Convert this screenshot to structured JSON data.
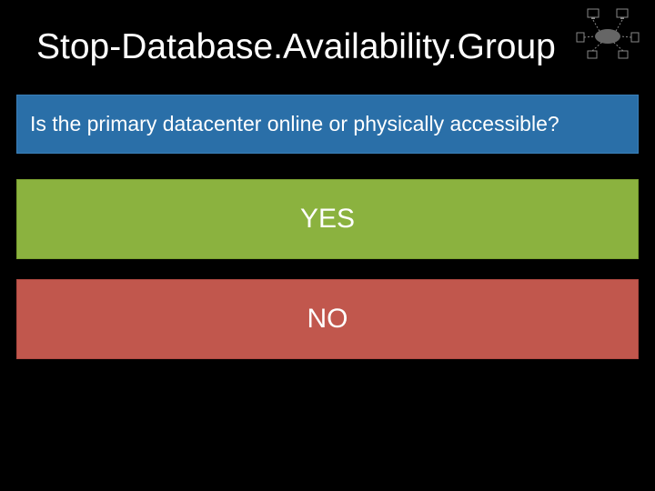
{
  "header": {
    "title": "Stop-Database.Availability.Group"
  },
  "question": {
    "text": "Is the primary datacenter online or physically accessible?"
  },
  "options": {
    "yes": "YES",
    "no": "NO"
  },
  "colors": {
    "question_bg": "#2a6fa8",
    "yes_bg": "#8bb23f",
    "no_bg": "#c1574d"
  }
}
